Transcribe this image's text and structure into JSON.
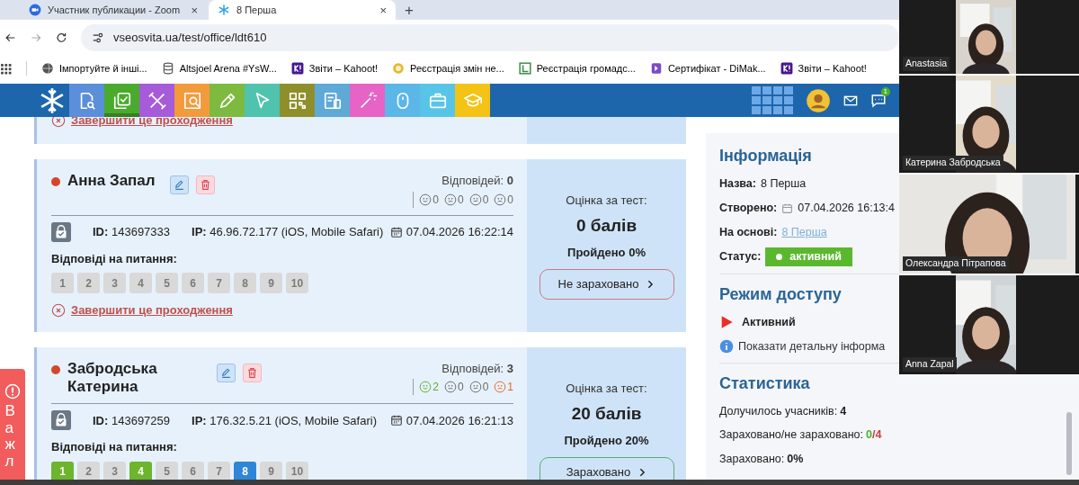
{
  "browser": {
    "tabs": [
      {
        "title": "Участник публикации - Zoom",
        "kind": "zoom",
        "selected": false,
        "close": "×"
      },
      {
        "title": "8 Перша",
        "kind": "snowflake",
        "selected": true,
        "close": "×"
      }
    ],
    "new_tab": "+",
    "url": "vseosvita.ua/test/office/ldt610",
    "bookmarks": [
      {
        "kind": "globe",
        "label": "Імпортуйте й інші..."
      },
      {
        "kind": "database",
        "label": "Altsjoel Arena #YsW..."
      },
      {
        "kind": "kahoot",
        "label": "Звіти – Kahoot!"
      },
      {
        "kind": "coin",
        "label": "Реєстрація змін не..."
      },
      {
        "kind": "ledger",
        "label": "Реєстрація громадс..."
      },
      {
        "kind": "certificate",
        "label": "Сертифікат - DiMak..."
      },
      {
        "kind": "kahoot",
        "label": "Звіти – Kahoot!"
      }
    ]
  },
  "site_nav": {
    "tools": [
      {
        "kind": "search-doc",
        "color": "#5b8fd9",
        "selected": false
      },
      {
        "kind": "check",
        "color": "#4aaa2c",
        "selected": true
      },
      {
        "kind": "tools",
        "color": "#a65bd9",
        "selected": false
      },
      {
        "kind": "chart-search",
        "color": "#f39a3b",
        "selected": false
      },
      {
        "kind": "pencil",
        "color": "#7dba3f",
        "selected": false
      },
      {
        "kind": "cursor",
        "color": "#4fc3ae",
        "selected": false
      },
      {
        "kind": "qr",
        "color": "#8e8f2b",
        "selected": false
      },
      {
        "kind": "doc-phone",
        "color": "#5ea9d6",
        "selected": false
      },
      {
        "kind": "wand",
        "color": "#e564c5",
        "selected": false
      },
      {
        "kind": "mouse",
        "color": "#5cb7e9",
        "selected": false
      },
      {
        "kind": "briefcase",
        "color": "#58c4e8",
        "selected": false
      },
      {
        "kind": "cap",
        "color": "#f3c315",
        "selected": false
      }
    ],
    "messages_badge": "1"
  },
  "cards": [
    {
      "kind": "partial",
      "end_link": "Завершити це проходження"
    },
    {
      "kind": "full",
      "name": "Анна Запал",
      "answers_label": "Відповідей:",
      "answers_count": "0",
      "reactions": [
        {
          "kind": "happy",
          "count": "0",
          "highlighted": false
        },
        {
          "kind": "neutral",
          "count": "0",
          "highlighted": false
        },
        {
          "kind": "unsure",
          "count": "0",
          "highlighted": false
        },
        {
          "kind": "sad",
          "count": "0",
          "highlighted": false
        }
      ],
      "id_label": "ID:",
      "id": "143697333",
      "ip_label": "IP:",
      "ip": "46.96.72.177 (iOS, Mobile Safari)",
      "date": "07.04.2026 16:22:14",
      "questions_label": "Відповіді на питання:",
      "questions": [
        {
          "label": "1",
          "kind": "empty"
        },
        {
          "label": "2",
          "kind": "empty"
        },
        {
          "label": "3",
          "kind": "empty"
        },
        {
          "label": "4",
          "kind": "empty"
        },
        {
          "label": "5",
          "kind": "empty"
        },
        {
          "label": "6",
          "kind": "empty"
        },
        {
          "label": "7",
          "kind": "empty"
        },
        {
          "label": "8",
          "kind": "empty"
        },
        {
          "label": "9",
          "kind": "empty"
        },
        {
          "label": "10",
          "kind": "empty"
        }
      ],
      "end_link": "Завершити це проходження",
      "score_label": "Оцінка за тест:",
      "score": "0 балів",
      "passed": "Пройдено 0%",
      "verdict": {
        "label": "Не зараховано",
        "kind": "failed"
      }
    },
    {
      "kind": "full",
      "name": "Забродська Катерина",
      "answers_label": "Відповідей:",
      "answers_count": "3",
      "reactions": [
        {
          "kind": "happy",
          "count": "2",
          "highlighted": true
        },
        {
          "kind": "neutral",
          "count": "0",
          "highlighted": false
        },
        {
          "kind": "unsure",
          "count": "0",
          "highlighted": false
        },
        {
          "kind": "sad",
          "count": "1",
          "highlighted": true
        }
      ],
      "id_label": "ID:",
      "id": "143697259",
      "ip_label": "IP:",
      "ip": "176.32.5.21 (iOS, Mobile Safari)",
      "date": "07.04.2026 16:21:13",
      "questions_label": "Відповіді на питання:",
      "questions": [
        {
          "label": "1",
          "kind": "correct"
        },
        {
          "label": "2",
          "kind": "empty"
        },
        {
          "label": "3",
          "kind": "empty"
        },
        {
          "label": "4",
          "kind": "correct"
        },
        {
          "label": "5",
          "kind": "empty"
        },
        {
          "label": "6",
          "kind": "empty"
        },
        {
          "label": "7",
          "kind": "empty"
        },
        {
          "label": "8",
          "kind": "answered"
        },
        {
          "label": "9",
          "kind": "empty"
        },
        {
          "label": "10",
          "kind": "empty"
        }
      ],
      "score_label": "Оцінка за тест:",
      "score": "20 балів",
      "passed": "Пройдено 20%",
      "verdict": {
        "label": "Зараховано",
        "kind": "passed"
      }
    }
  ],
  "info": {
    "title": "Інформація",
    "fields": [
      {
        "label": "Назва:",
        "value": "8 Перша",
        "kind": "text"
      },
      {
        "label": "Створено:",
        "value": "07.04.2026 16:13:4",
        "kind": "date"
      },
      {
        "label": "На основі:",
        "value": "8 Перша",
        "kind": "link"
      },
      {
        "label": "Статус:",
        "value": "активний",
        "kind": "badge"
      }
    ],
    "access": {
      "title": "Режим доступу",
      "mode": "Активний",
      "details": "Показати детальну інформа"
    },
    "stats": {
      "title": "Статистика",
      "rows": [
        {
          "label": "Долучилось учасників:",
          "parts": [
            {
              "text": "4",
              "kind": "plain"
            }
          ]
        },
        {
          "label": "Зараховано/не зараховано:",
          "parts": [
            {
              "text": "0",
              "kind": "good"
            },
            {
              "text": "/4",
              "kind": "bad"
            }
          ]
        },
        {
          "label": "Зараховано:",
          "parts": [
            {
              "text": "0%",
              "kind": "plain"
            }
          ]
        }
      ]
    }
  },
  "side_tab": {
    "text": "Важл"
  },
  "video_tiles": [
    {
      "name": "Anastasia",
      "kind": "portrait"
    },
    {
      "name": "Катерина Забродська",
      "kind": "portrait"
    },
    {
      "name": "Олександра Пітрапова",
      "kind": "wide"
    },
    {
      "name": "Anna Zapal",
      "kind": "portrait"
    }
  ]
}
